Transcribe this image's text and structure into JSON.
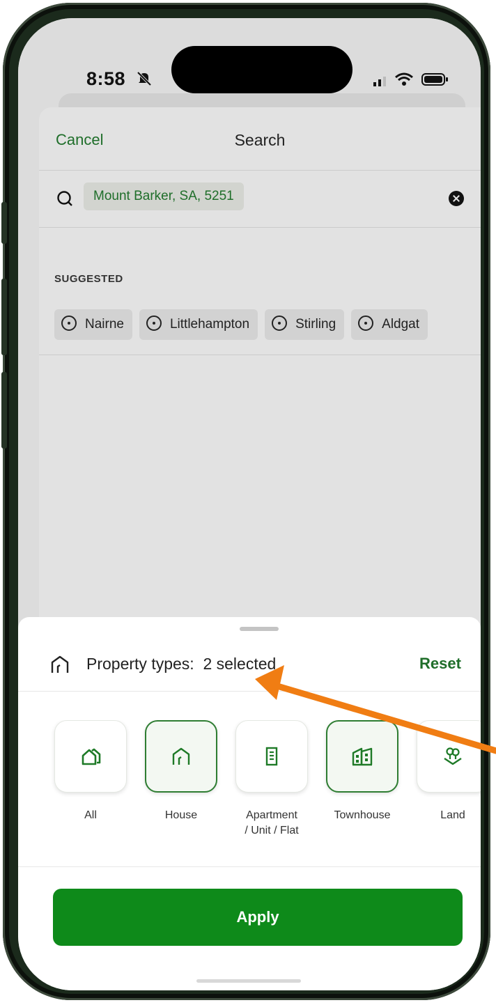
{
  "status_bar": {
    "time": "8:58"
  },
  "nav": {
    "cancel_label": "Cancel",
    "title": "Search"
  },
  "search": {
    "location_chip": "Mount Barker, SA, 5251"
  },
  "suggested": {
    "label": "SUGGESTED",
    "items": [
      "Nairne",
      "Littlehampton",
      "Stirling",
      "Aldgat"
    ]
  },
  "property_types": {
    "label": "Property types:  2 selected",
    "reset_label": "Reset",
    "options": [
      {
        "label": "All",
        "icon": "home-outline-icon",
        "selected": false
      },
      {
        "label": "House",
        "icon": "house-icon",
        "selected": true
      },
      {
        "label": "Apartment\n/ Unit / Flat",
        "icon": "apartment-icon",
        "selected": false
      },
      {
        "label": "Townhouse",
        "icon": "townhouse-icon",
        "selected": true
      },
      {
        "label": "Land",
        "icon": "land-icon",
        "selected": false
      }
    ]
  },
  "apply_label": "Apply",
  "colors": {
    "accent": "#1f6e2a",
    "button": "#0e8a1a",
    "arrow": "#f07d13"
  }
}
